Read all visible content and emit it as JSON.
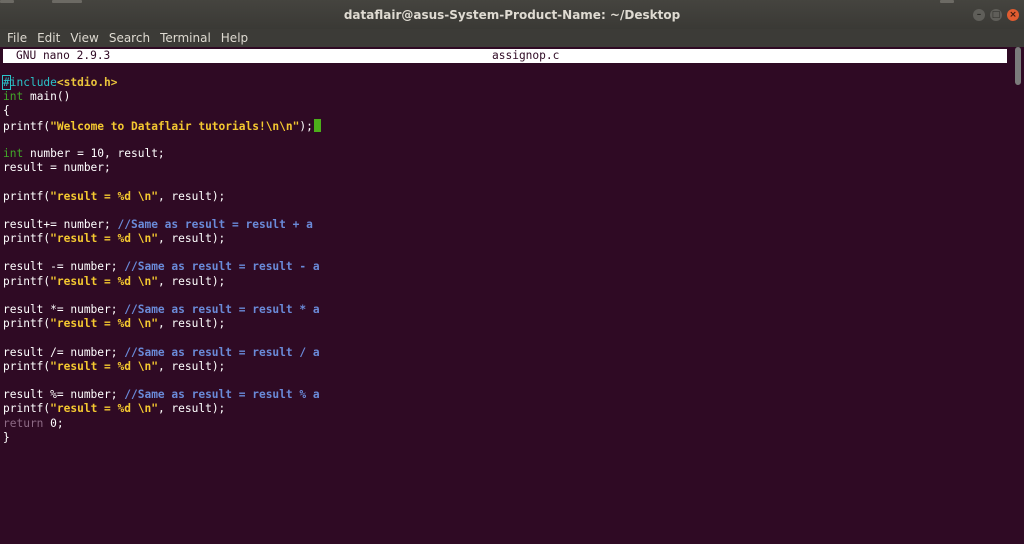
{
  "window": {
    "title": "dataflair@asus-System-Product-Name: ~/Desktop",
    "buttons": {
      "minimize": "–",
      "maximize": "□",
      "close": "×"
    }
  },
  "menu": [
    "File",
    "Edit",
    "View",
    "Search",
    "Terminal",
    "Help"
  ],
  "nano": {
    "version": "GNU nano 2.9.3",
    "filename": "assignop.c"
  },
  "colors": {
    "terminal_background": "#2f0a24",
    "directive": "#2ac3c9",
    "string": "#f4c830",
    "type": "#42a829",
    "comment": "#6a8ad8",
    "keyword": "#8d6a85",
    "cursor": "#4cae1a"
  },
  "code_lines": [
    [
      {
        "t": "#",
        "c": "directive hash-cursor"
      },
      {
        "t": "include",
        "c": "directive"
      },
      {
        "t": "<stdio.h>",
        "c": "header"
      }
    ],
    [
      {
        "t": "int",
        "c": "type"
      },
      {
        "t": " main()",
        "c": "plain"
      }
    ],
    [
      {
        "t": "{",
        "c": "plain"
      }
    ],
    [
      {
        "t": "printf(",
        "c": "plain"
      },
      {
        "t": "\"Welcome to Dataflair tutorials!\\n\\n\"",
        "c": "string"
      },
      {
        "t": ");",
        "c": "plain"
      },
      {
        "t": "",
        "c": "cursor"
      }
    ],
    [],
    [
      {
        "t": "int",
        "c": "type"
      },
      {
        "t": " number = 10, result;",
        "c": "plain"
      }
    ],
    [
      {
        "t": "result = number;",
        "c": "plain"
      }
    ],
    [],
    [
      {
        "t": "printf(",
        "c": "plain"
      },
      {
        "t": "\"result = %d \\n\"",
        "c": "string"
      },
      {
        "t": ", result);",
        "c": "plain"
      }
    ],
    [],
    [
      {
        "t": "result+= number; ",
        "c": "plain"
      },
      {
        "t": "//Same as result = result + a",
        "c": "comment"
      }
    ],
    [
      {
        "t": "printf(",
        "c": "plain"
      },
      {
        "t": "\"result = %d \\n\"",
        "c": "string"
      },
      {
        "t": ", result);",
        "c": "plain"
      }
    ],
    [],
    [
      {
        "t": "result -= number; ",
        "c": "plain"
      },
      {
        "t": "//Same as result = result - a",
        "c": "comment"
      }
    ],
    [
      {
        "t": "printf(",
        "c": "plain"
      },
      {
        "t": "\"result = %d \\n\"",
        "c": "string"
      },
      {
        "t": ", result);",
        "c": "plain"
      }
    ],
    [],
    [
      {
        "t": "result *= number; ",
        "c": "plain"
      },
      {
        "t": "//Same as result = result * a",
        "c": "comment"
      }
    ],
    [
      {
        "t": "printf(",
        "c": "plain"
      },
      {
        "t": "\"result = %d \\n\"",
        "c": "string"
      },
      {
        "t": ", result);",
        "c": "plain"
      }
    ],
    [],
    [
      {
        "t": "result /= number; ",
        "c": "plain"
      },
      {
        "t": "//Same as result = result / a",
        "c": "comment"
      }
    ],
    [
      {
        "t": "printf(",
        "c": "plain"
      },
      {
        "t": "\"result = %d \\n\"",
        "c": "string"
      },
      {
        "t": ", result);",
        "c": "plain"
      }
    ],
    [],
    [
      {
        "t": "result %= number; ",
        "c": "plain"
      },
      {
        "t": "//Same as result = result % a",
        "c": "comment"
      }
    ],
    [
      {
        "t": "printf(",
        "c": "plain"
      },
      {
        "t": "\"result = %d \\n\"",
        "c": "string"
      },
      {
        "t": ", result);",
        "c": "plain"
      }
    ],
    [
      {
        "t": "return",
        "c": "keyword"
      },
      {
        "t": " 0;",
        "c": "plain"
      }
    ],
    [
      {
        "t": "}",
        "c": "plain"
      }
    ]
  ]
}
